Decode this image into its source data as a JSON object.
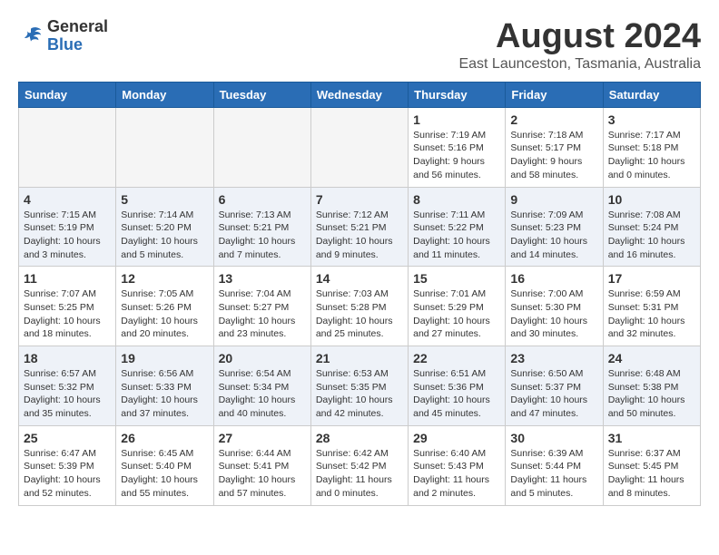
{
  "logo": {
    "general": "General",
    "blue": "Blue"
  },
  "title": "August 2024",
  "subtitle": "East Launceston, Tasmania, Australia",
  "days_header": [
    "Sunday",
    "Monday",
    "Tuesday",
    "Wednesday",
    "Thursday",
    "Friday",
    "Saturday"
  ],
  "weeks": [
    [
      {
        "num": "",
        "info": ""
      },
      {
        "num": "",
        "info": ""
      },
      {
        "num": "",
        "info": ""
      },
      {
        "num": "",
        "info": ""
      },
      {
        "num": "1",
        "info": "Sunrise: 7:19 AM\nSunset: 5:16 PM\nDaylight: 9 hours and 56 minutes."
      },
      {
        "num": "2",
        "info": "Sunrise: 7:18 AM\nSunset: 5:17 PM\nDaylight: 9 hours and 58 minutes."
      },
      {
        "num": "3",
        "info": "Sunrise: 7:17 AM\nSunset: 5:18 PM\nDaylight: 10 hours and 0 minutes."
      }
    ],
    [
      {
        "num": "4",
        "info": "Sunrise: 7:15 AM\nSunset: 5:19 PM\nDaylight: 10 hours and 3 minutes."
      },
      {
        "num": "5",
        "info": "Sunrise: 7:14 AM\nSunset: 5:20 PM\nDaylight: 10 hours and 5 minutes."
      },
      {
        "num": "6",
        "info": "Sunrise: 7:13 AM\nSunset: 5:21 PM\nDaylight: 10 hours and 7 minutes."
      },
      {
        "num": "7",
        "info": "Sunrise: 7:12 AM\nSunset: 5:21 PM\nDaylight: 10 hours and 9 minutes."
      },
      {
        "num": "8",
        "info": "Sunrise: 7:11 AM\nSunset: 5:22 PM\nDaylight: 10 hours and 11 minutes."
      },
      {
        "num": "9",
        "info": "Sunrise: 7:09 AM\nSunset: 5:23 PM\nDaylight: 10 hours and 14 minutes."
      },
      {
        "num": "10",
        "info": "Sunrise: 7:08 AM\nSunset: 5:24 PM\nDaylight: 10 hours and 16 minutes."
      }
    ],
    [
      {
        "num": "11",
        "info": "Sunrise: 7:07 AM\nSunset: 5:25 PM\nDaylight: 10 hours and 18 minutes."
      },
      {
        "num": "12",
        "info": "Sunrise: 7:05 AM\nSunset: 5:26 PM\nDaylight: 10 hours and 20 minutes."
      },
      {
        "num": "13",
        "info": "Sunrise: 7:04 AM\nSunset: 5:27 PM\nDaylight: 10 hours and 23 minutes."
      },
      {
        "num": "14",
        "info": "Sunrise: 7:03 AM\nSunset: 5:28 PM\nDaylight: 10 hours and 25 minutes."
      },
      {
        "num": "15",
        "info": "Sunrise: 7:01 AM\nSunset: 5:29 PM\nDaylight: 10 hours and 27 minutes."
      },
      {
        "num": "16",
        "info": "Sunrise: 7:00 AM\nSunset: 5:30 PM\nDaylight: 10 hours and 30 minutes."
      },
      {
        "num": "17",
        "info": "Sunrise: 6:59 AM\nSunset: 5:31 PM\nDaylight: 10 hours and 32 minutes."
      }
    ],
    [
      {
        "num": "18",
        "info": "Sunrise: 6:57 AM\nSunset: 5:32 PM\nDaylight: 10 hours and 35 minutes."
      },
      {
        "num": "19",
        "info": "Sunrise: 6:56 AM\nSunset: 5:33 PM\nDaylight: 10 hours and 37 minutes."
      },
      {
        "num": "20",
        "info": "Sunrise: 6:54 AM\nSunset: 5:34 PM\nDaylight: 10 hours and 40 minutes."
      },
      {
        "num": "21",
        "info": "Sunrise: 6:53 AM\nSunset: 5:35 PM\nDaylight: 10 hours and 42 minutes."
      },
      {
        "num": "22",
        "info": "Sunrise: 6:51 AM\nSunset: 5:36 PM\nDaylight: 10 hours and 45 minutes."
      },
      {
        "num": "23",
        "info": "Sunrise: 6:50 AM\nSunset: 5:37 PM\nDaylight: 10 hours and 47 minutes."
      },
      {
        "num": "24",
        "info": "Sunrise: 6:48 AM\nSunset: 5:38 PM\nDaylight: 10 hours and 50 minutes."
      }
    ],
    [
      {
        "num": "25",
        "info": "Sunrise: 6:47 AM\nSunset: 5:39 PM\nDaylight: 10 hours and 52 minutes."
      },
      {
        "num": "26",
        "info": "Sunrise: 6:45 AM\nSunset: 5:40 PM\nDaylight: 10 hours and 55 minutes."
      },
      {
        "num": "27",
        "info": "Sunrise: 6:44 AM\nSunset: 5:41 PM\nDaylight: 10 hours and 57 minutes."
      },
      {
        "num": "28",
        "info": "Sunrise: 6:42 AM\nSunset: 5:42 PM\nDaylight: 11 hours and 0 minutes."
      },
      {
        "num": "29",
        "info": "Sunrise: 6:40 AM\nSunset: 5:43 PM\nDaylight: 11 hours and 2 minutes."
      },
      {
        "num": "30",
        "info": "Sunrise: 6:39 AM\nSunset: 5:44 PM\nDaylight: 11 hours and 5 minutes."
      },
      {
        "num": "31",
        "info": "Sunrise: 6:37 AM\nSunset: 5:45 PM\nDaylight: 11 hours and 8 minutes."
      }
    ]
  ]
}
